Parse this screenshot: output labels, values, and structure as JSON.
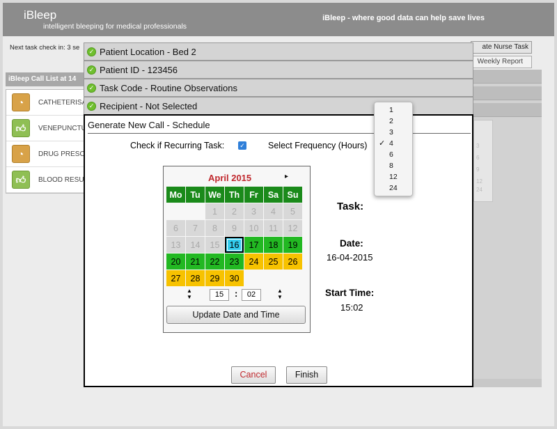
{
  "app": {
    "title": "iBleep",
    "subtitle": "intelligent bleeping for medical professionals",
    "slogan": "iBleep - where good data can help save lives"
  },
  "background": {
    "task_checkin": "Next task check in: 3 se",
    "nurse_task_button": "ate Nurse Task",
    "weekly_report_button": "Weekly Report",
    "call_list_header": "iBleep Call List at 14",
    "call_list": [
      {
        "name": "CATHETERISA",
        "icon": "rss-icon"
      },
      {
        "name": "VENEPUNCTU",
        "icon": "thumbs-up-icon"
      },
      {
        "name": "DRUG PRESCI",
        "icon": "rss-icon"
      },
      {
        "name": "BLOOD RESUI",
        "icon": "thumbs-up-icon"
      }
    ],
    "right_numbers": [
      "3",
      "6",
      "9",
      "12",
      "24"
    ]
  },
  "accordion": [
    {
      "label": "Patient Location - Bed 2"
    },
    {
      "label": "Patient ID - 123456"
    },
    {
      "label": "Task Code - Routine Observations"
    },
    {
      "label": "Recipient - Not Selected"
    }
  ],
  "modal": {
    "title": "Generate New Call - Schedule",
    "recurring_label": "Check if Recurring Task:",
    "recurring_checked": true,
    "frequency_label": "Select Frequency (Hours)",
    "task_label": "Task:",
    "date_label": "Date:",
    "date_value": "16-04-2015",
    "start_time_label": "Start Time:",
    "start_time_value": "15:02",
    "cancel_label": "Cancel",
    "finish_label": "Finish"
  },
  "calendar": {
    "month_label": "April 2015",
    "next_arrow": "▸",
    "weekdays": [
      "Mo",
      "Tu",
      "We",
      "Th",
      "Fr",
      "Sa",
      "Su"
    ],
    "days": [
      {
        "d": "",
        "s": "empty"
      },
      {
        "d": "",
        "s": "empty"
      },
      {
        "d": "1",
        "s": "past"
      },
      {
        "d": "2",
        "s": "past"
      },
      {
        "d": "3",
        "s": "past"
      },
      {
        "d": "4",
        "s": "past"
      },
      {
        "d": "5",
        "s": "past"
      },
      {
        "d": "6",
        "s": "past"
      },
      {
        "d": "7",
        "s": "past"
      },
      {
        "d": "8",
        "s": "past"
      },
      {
        "d": "9",
        "s": "past"
      },
      {
        "d": "10",
        "s": "past"
      },
      {
        "d": "11",
        "s": "past"
      },
      {
        "d": "12",
        "s": "past"
      },
      {
        "d": "13",
        "s": "past"
      },
      {
        "d": "14",
        "s": "past"
      },
      {
        "d": "15",
        "s": "past"
      },
      {
        "d": "16",
        "s": "today"
      },
      {
        "d": "17",
        "s": "green"
      },
      {
        "d": "18",
        "s": "green"
      },
      {
        "d": "19",
        "s": "green"
      },
      {
        "d": "20",
        "s": "green"
      },
      {
        "d": "21",
        "s": "green"
      },
      {
        "d": "22",
        "s": "green"
      },
      {
        "d": "23",
        "s": "green"
      },
      {
        "d": "24",
        "s": "yellow"
      },
      {
        "d": "25",
        "s": "yellow"
      },
      {
        "d": "26",
        "s": "yellow"
      },
      {
        "d": "27",
        "s": "yellow"
      },
      {
        "d": "28",
        "s": "yellow"
      },
      {
        "d": "29",
        "s": "yellow"
      },
      {
        "d": "30",
        "s": "yellow"
      }
    ],
    "hour": "15",
    "minute": "02",
    "time_separator": ":",
    "update_button": "Update Date and Time"
  },
  "frequency_dropdown": {
    "options": [
      "1",
      "2",
      "3",
      "4",
      "6",
      "8",
      "12",
      "24"
    ],
    "selected": "4"
  },
  "colors": {
    "header_bg": "#8c8c8c",
    "weekday_green": "#1a8a1a",
    "available_green": "#22b822",
    "available_yellow": "#f7c200",
    "today_cyan": "#33ccee",
    "month_red": "#c0282d",
    "check_green": "#6fbf2e"
  }
}
